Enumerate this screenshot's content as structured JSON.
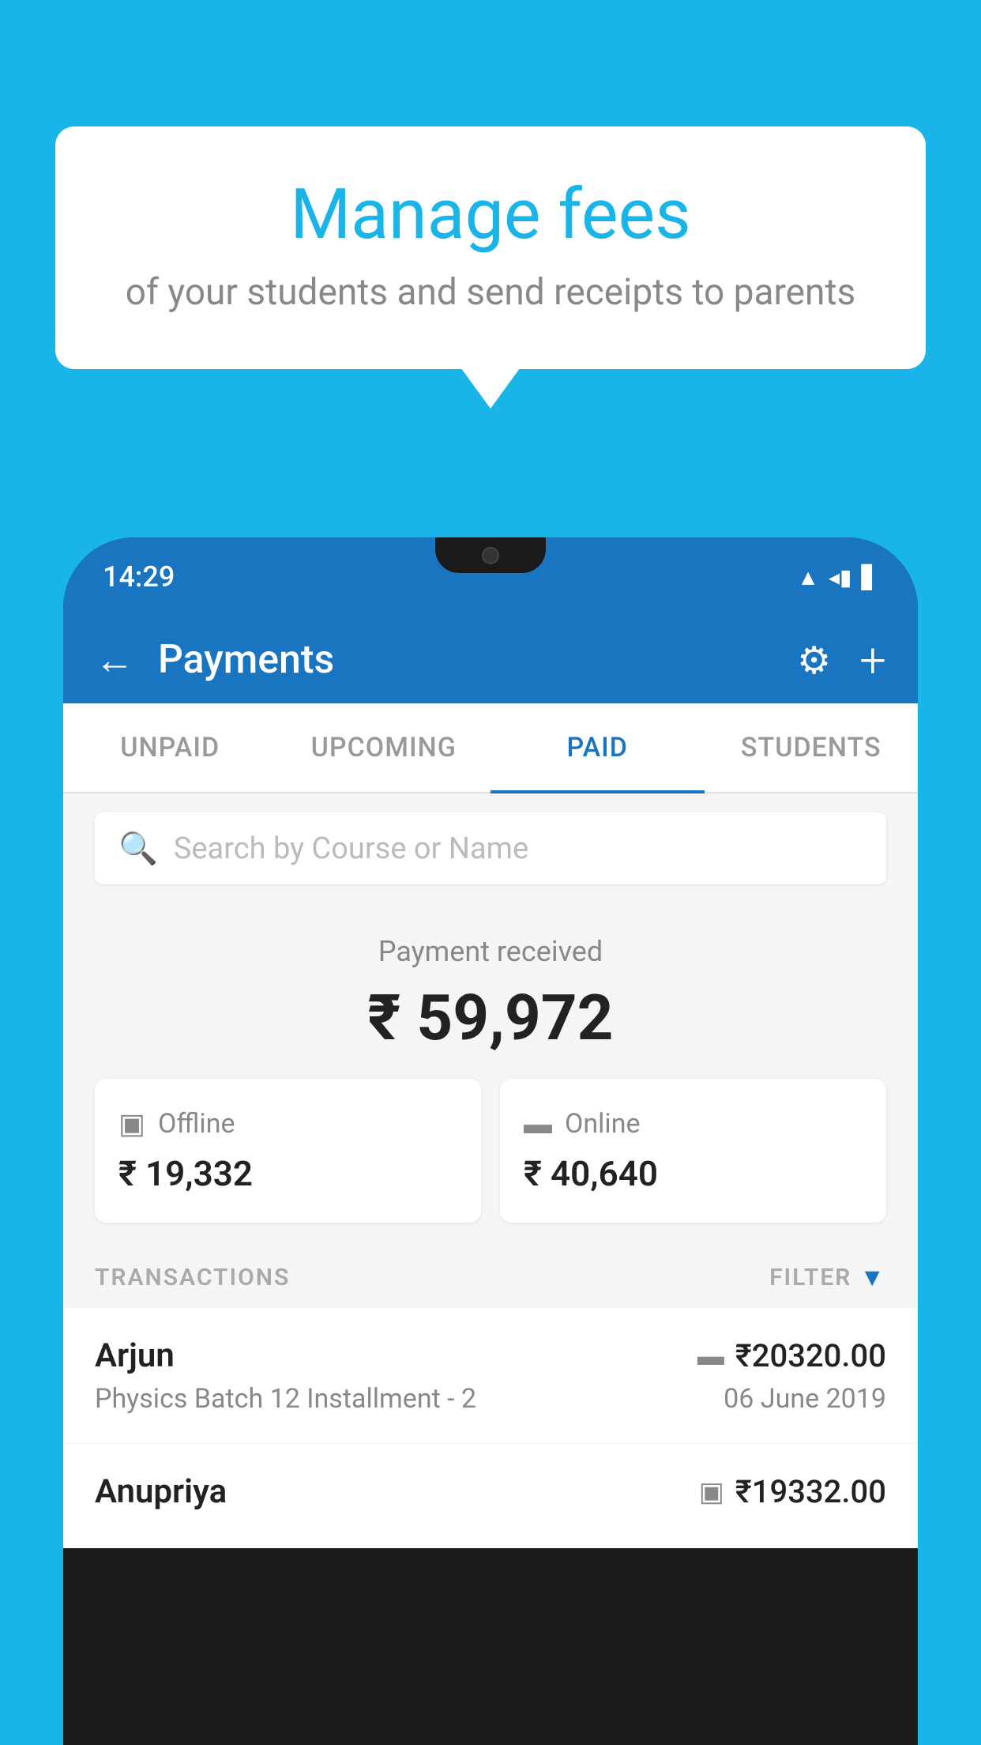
{
  "background_color": "#1ab5e8",
  "speech_bubble": {
    "title": "Manage fees",
    "subtitle": "of your students and send receipts to parents"
  },
  "phone": {
    "status_bar": {
      "time": "14:29"
    },
    "header": {
      "back_label": "←",
      "title": "Payments",
      "gear_label": "⚙",
      "plus_label": "+"
    },
    "tabs": [
      {
        "label": "UNPAID",
        "active": false
      },
      {
        "label": "UPCOMING",
        "active": false
      },
      {
        "label": "PAID",
        "active": true
      },
      {
        "label": "STUDENTS",
        "active": false
      }
    ],
    "search": {
      "placeholder": "Search by Course or Name"
    },
    "payment_section": {
      "label": "Payment received",
      "total_amount": "₹ 59,972",
      "offline": {
        "label": "Offline",
        "amount": "₹ 19,332"
      },
      "online": {
        "label": "Online",
        "amount": "₹ 40,640"
      }
    },
    "transactions": {
      "header_label": "TRANSACTIONS",
      "filter_label": "FILTER",
      "rows": [
        {
          "name": "Arjun",
          "amount": "₹20320.00",
          "course": "Physics Batch 12 Installment - 2",
          "date": "06 June 2019",
          "payment_type": "online"
        },
        {
          "name": "Anupriya",
          "amount": "₹19332.00",
          "course": "",
          "date": "",
          "payment_type": "offline"
        }
      ]
    }
  }
}
